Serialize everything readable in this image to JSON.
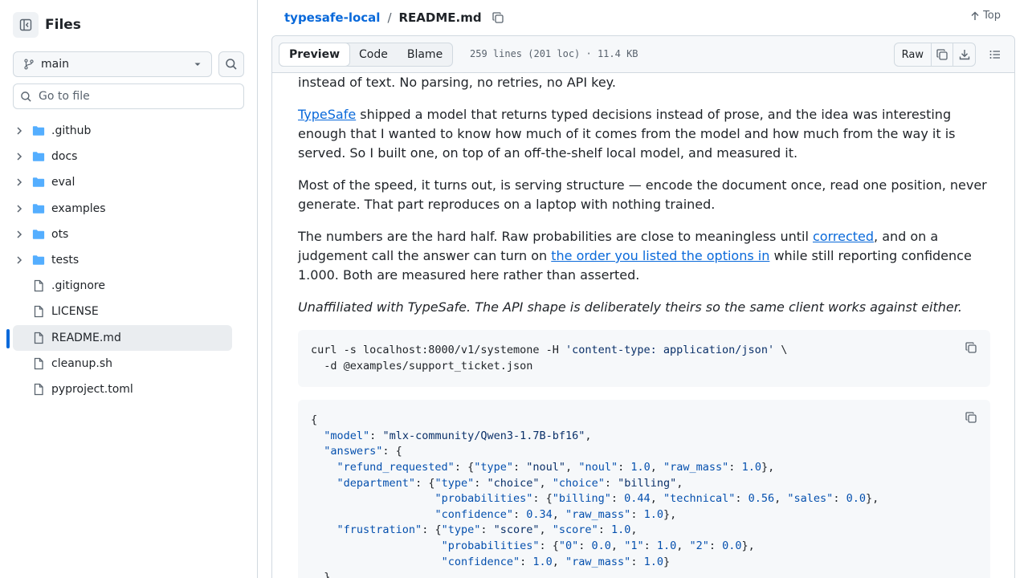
{
  "sidebar": {
    "title": "Files",
    "branch": "main",
    "goto_placeholder": "Go to file",
    "folders": [
      ".github",
      "docs",
      "eval",
      "examples",
      "ots",
      "tests"
    ],
    "files": [
      ".gitignore",
      "LICENSE",
      "README.md",
      "cleanup.sh",
      "pyproject.toml"
    ],
    "active_file": "README.md"
  },
  "header": {
    "repo": "typesafe-local",
    "separator": "/",
    "file": "README.md",
    "top_label": "Top"
  },
  "toolbar": {
    "tabs": [
      "Preview",
      "Code",
      "Blame"
    ],
    "active_tab": "Preview",
    "meta": "259 lines (201 loc) · 11.4 KB",
    "raw_label": "Raw"
  },
  "readme": {
    "p0": "instead of text. No parsing, no retries, no API key.",
    "p1_link": "TypeSafe",
    "p1_rest": " shipped a model that returns typed decisions instead of prose, and the idea was interesting enough that I wanted to know how much of it comes from the model and how much from the way it is served. So I built one, on top of an off-the-shelf local model, and measured it.",
    "p2": "Most of the speed, it turns out, is serving structure — encode the document once, read one position, never generate. That part reproduces on a laptop with nothing trained.",
    "p3_a": "The numbers are the hard half. Raw probabilities are close to meaningless until ",
    "p3_link1": "corrected",
    "p3_b": ", and on a judgement call the answer can turn on ",
    "p3_link2": "the order you listed the options in",
    "p3_c": " while still reporting confidence 1.000. Both are measured here rather than asserted.",
    "p4": "Unaffiliated with TypeSafe. The API shape is deliberately theirs so the same client works against either.",
    "code1": [
      [
        [
          "curl -s localhost:8000/v1/systemone -H ",
          ""
        ],
        [
          "'content-type: application/json'",
          "s"
        ],
        [
          " \\",
          ""
        ]
      ],
      [
        [
          "  -d @examples/support_ticket.json",
          ""
        ]
      ]
    ],
    "code2": [
      [
        [
          "{",
          ""
        ]
      ],
      [
        [
          "  ",
          ""
        ],
        [
          "\"model\"",
          "n"
        ],
        [
          ": ",
          ""
        ],
        [
          "\"mlx-community/Qwen3-1.7B-bf16\"",
          "s"
        ],
        [
          ",",
          ""
        ]
      ],
      [
        [
          "  ",
          ""
        ],
        [
          "\"answers\"",
          "n"
        ],
        [
          ": {",
          ""
        ]
      ],
      [
        [
          "    ",
          ""
        ],
        [
          "\"refund_requested\"",
          "n"
        ],
        [
          ": {",
          ""
        ],
        [
          "\"type\"",
          "n"
        ],
        [
          ": ",
          ""
        ],
        [
          "\"noul\"",
          "s"
        ],
        [
          ", ",
          ""
        ],
        [
          "\"noul\"",
          "n"
        ],
        [
          ": ",
          ""
        ],
        [
          "1.0",
          "n"
        ],
        [
          ", ",
          ""
        ],
        [
          "\"raw_mass\"",
          "n"
        ],
        [
          ": ",
          ""
        ],
        [
          "1.0",
          "n"
        ],
        [
          "},",
          ""
        ]
      ],
      [
        [
          "    ",
          ""
        ],
        [
          "\"department\"",
          "n"
        ],
        [
          ": {",
          ""
        ],
        [
          "\"type\"",
          "n"
        ],
        [
          ": ",
          ""
        ],
        [
          "\"choice\"",
          "s"
        ],
        [
          ", ",
          ""
        ],
        [
          "\"choice\"",
          "n"
        ],
        [
          ": ",
          ""
        ],
        [
          "\"billing\"",
          "s"
        ],
        [
          ",",
          ""
        ]
      ],
      [
        [
          "                   ",
          ""
        ],
        [
          "\"probabilities\"",
          "n"
        ],
        [
          ": {",
          ""
        ],
        [
          "\"billing\"",
          "n"
        ],
        [
          ": ",
          ""
        ],
        [
          "0.44",
          "n"
        ],
        [
          ", ",
          ""
        ],
        [
          "\"technical\"",
          "n"
        ],
        [
          ": ",
          ""
        ],
        [
          "0.56",
          "n"
        ],
        [
          ", ",
          ""
        ],
        [
          "\"sales\"",
          "n"
        ],
        [
          ": ",
          ""
        ],
        [
          "0.0",
          "n"
        ],
        [
          "},",
          ""
        ]
      ],
      [
        [
          "                   ",
          ""
        ],
        [
          "\"confidence\"",
          "n"
        ],
        [
          ": ",
          ""
        ],
        [
          "0.34",
          "n"
        ],
        [
          ", ",
          ""
        ],
        [
          "\"raw_mass\"",
          "n"
        ],
        [
          ": ",
          ""
        ],
        [
          "1.0",
          "n"
        ],
        [
          "},",
          ""
        ]
      ],
      [
        [
          "    ",
          ""
        ],
        [
          "\"frustration\"",
          "n"
        ],
        [
          ": {",
          ""
        ],
        [
          "\"type\"",
          "n"
        ],
        [
          ": ",
          ""
        ],
        [
          "\"score\"",
          "s"
        ],
        [
          ", ",
          ""
        ],
        [
          "\"score\"",
          "n"
        ],
        [
          ": ",
          ""
        ],
        [
          "1.0",
          "n"
        ],
        [
          ",",
          ""
        ]
      ],
      [
        [
          "                    ",
          ""
        ],
        [
          "\"probabilities\"",
          "n"
        ],
        [
          ": {",
          ""
        ],
        [
          "\"0\"",
          "n"
        ],
        [
          ": ",
          ""
        ],
        [
          "0.0",
          "n"
        ],
        [
          ", ",
          ""
        ],
        [
          "\"1\"",
          "n"
        ],
        [
          ": ",
          ""
        ],
        [
          "1.0",
          "n"
        ],
        [
          ", ",
          ""
        ],
        [
          "\"2\"",
          "n"
        ],
        [
          ": ",
          ""
        ],
        [
          "0.0",
          "n"
        ],
        [
          "},",
          ""
        ]
      ],
      [
        [
          "                    ",
          ""
        ],
        [
          "\"confidence\"",
          "n"
        ],
        [
          ": ",
          ""
        ],
        [
          "1.0",
          "n"
        ],
        [
          ", ",
          ""
        ],
        [
          "\"raw_mass\"",
          "n"
        ],
        [
          ": ",
          ""
        ],
        [
          "1.0",
          "n"
        ],
        [
          "}",
          ""
        ]
      ],
      [
        [
          "  }",
          ""
        ]
      ]
    ]
  },
  "colors": {
    "link": "#0969da",
    "active_bar": "#0969da",
    "folder": "#54aeff"
  }
}
